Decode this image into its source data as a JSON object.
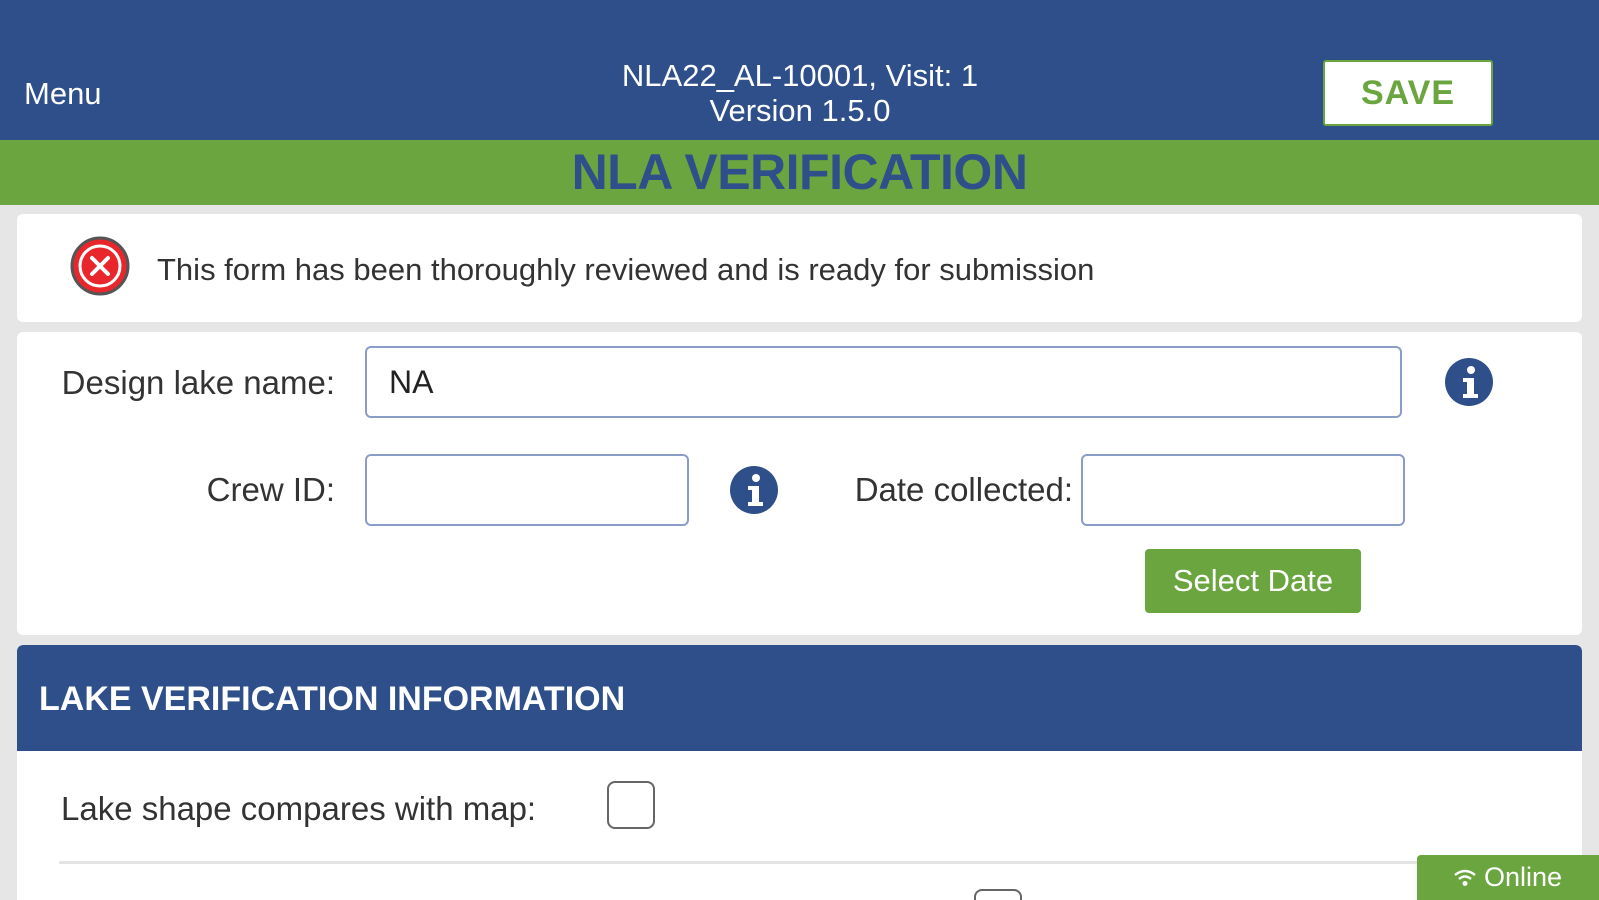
{
  "header": {
    "menu_label": "Menu",
    "site_visit": "NLA22_AL-10001, Visit: 1",
    "version": "Version 1.5.0",
    "save_label": "SAVE"
  },
  "form": {
    "title": "NLA VERIFICATION"
  },
  "review_status": {
    "icon": "error-x-icon",
    "text": "This form has been thoroughly reviewed and is ready for submission",
    "checked": false
  },
  "fields": {
    "design_lake_name": {
      "label": "Design lake name:",
      "value": "NA"
    },
    "crew_id": {
      "label": "Crew ID:",
      "value": ""
    },
    "date_collected": {
      "label": "Date collected:",
      "value": ""
    },
    "select_date_label": "Select Date"
  },
  "section": {
    "title": "LAKE VERIFICATION INFORMATION",
    "rows": [
      {
        "label": "Lake shape compares with map:",
        "checked": false
      }
    ]
  },
  "connection": {
    "status": "Online",
    "icon": "wifi-icon"
  },
  "colors": {
    "primary_blue": "#2f4f8a",
    "accent_green": "#6aa53f",
    "error_red": "#e8262c"
  }
}
